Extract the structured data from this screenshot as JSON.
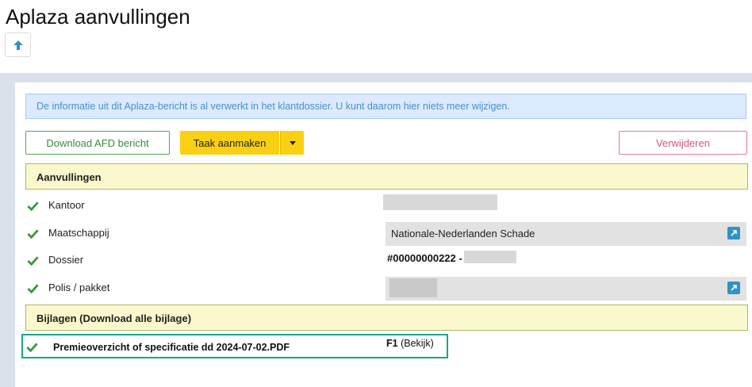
{
  "page": {
    "title": "Aplaza aanvullingen"
  },
  "alert": {
    "text": "De informatie uit dit Aplaza-bericht is al verwerkt in het klantdossier. U kunt daarom hier niets meer wijzigen."
  },
  "toolbar": {
    "download_label": "Download AFD bericht",
    "task_label": "Taak aanmaken",
    "delete_label": "Verwijderen"
  },
  "sections": {
    "aanvullingen_title": "Aanvullingen",
    "bijlagen_title": "Bijlagen (Download alle bijlage)"
  },
  "fields": [
    {
      "label": "Kantoor",
      "value": ""
    },
    {
      "label": "Maatschappij",
      "value": "Nationale-Nederlanden Schade"
    },
    {
      "label": "Dossier",
      "value": "#00000000222 -"
    },
    {
      "label": "Polis / pakket",
      "value": ""
    }
  ],
  "attachment": {
    "name": "Premieoverzicht of specificatie dd 2024-07-02.PDF",
    "code": "F1",
    "view_label": "(Bekijk)"
  },
  "colors": {
    "check": "#3a9a3a",
    "accent_yellow": "#fcd012",
    "link_blue": "#2e93c6"
  },
  "icons": {
    "up": "arrow-up-icon",
    "check": "checkmark-icon",
    "external": "external-link-icon"
  }
}
